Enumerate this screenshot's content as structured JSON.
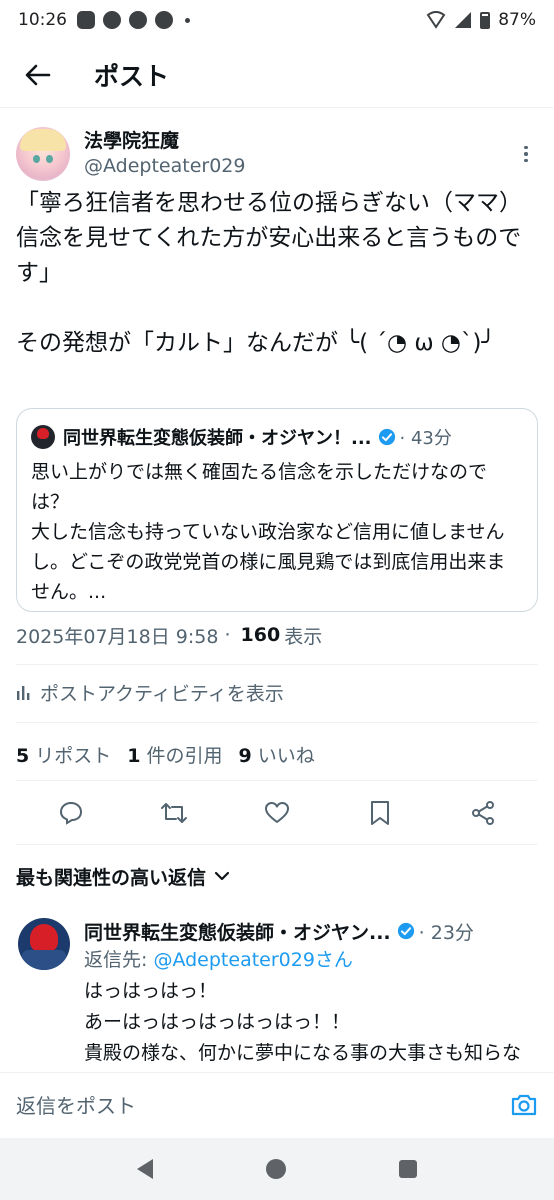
{
  "status_bar": {
    "time": "10:26",
    "notification_icons": [
      "line-icon",
      "messenger-icon",
      "facebook-icon",
      "facebook-icon"
    ],
    "battery": "87%"
  },
  "header": {
    "title": "ポスト"
  },
  "post": {
    "display_name": "法學院狂魔",
    "handle": "@Adepteater029",
    "text": "「寧ろ狂信者を思わせる位の揺らぎない（ママ）信念を見せてくれた方が安心出来ると言うものです」\n\nその発想が「カルト」なんだが ╰( ´◔ ω ◔`)╯",
    "date": "2025年07月18日 9:58",
    "views_count": "160",
    "views_label": "表示",
    "activity_label": "ポストアクティビティを表示",
    "reposts_count": "5",
    "reposts_label": "リポスト",
    "quotes_count": "1",
    "quotes_label": "件の引用",
    "likes_count": "9",
    "likes_label": "いいね"
  },
  "quote": {
    "name": "同世界転生変態仮装師・オジヤン！...",
    "time": "· 43分",
    "text": "思い上がりでは無く確固たる信念を示しただけなのでは？\n大した信念も持っていない政治家など信用に値しませんし。どこぞの政党党首の様に風見鶏では到底信用出来ません。..."
  },
  "replies_section": {
    "label": "最も関連性の高い返信"
  },
  "reply": {
    "name": "同世界転生変態仮装師・オジヤン...",
    "time": "· 23分",
    "reply_to_prefix": "返信先: ",
    "reply_to_handle": "@Adepteater029さん",
    "text": "はっはっはっ！\nあーはっはっはっはっはっ！！\n貴殿の様な、何かに夢中になる事の大事さも知らないで年だけ喰った駄目人間は退務で見てい"
  },
  "composer": {
    "placeholder": "返信をポスト"
  },
  "colors": {
    "accent": "#1d9bf0",
    "text": "#0f1419",
    "secondary": "#536471"
  }
}
